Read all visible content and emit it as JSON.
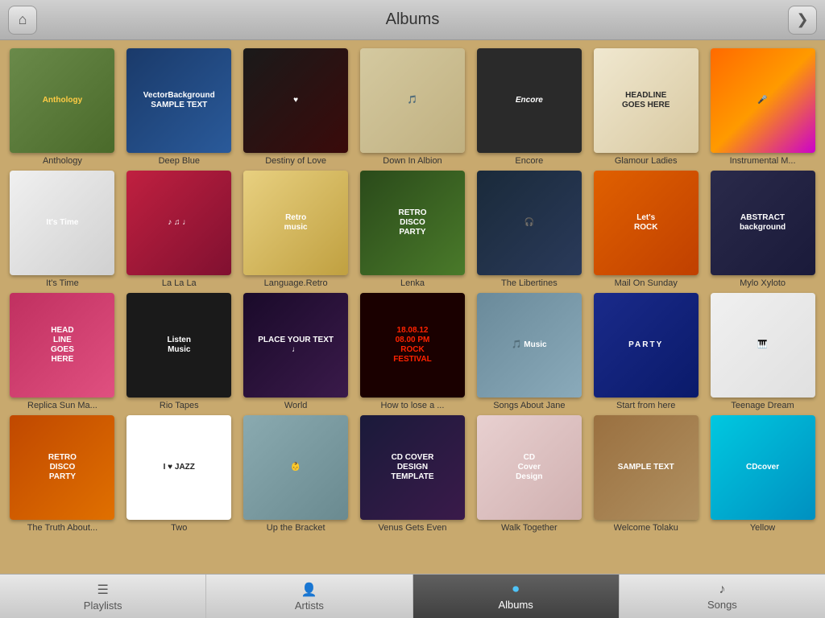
{
  "header": {
    "title": "Albums",
    "home_btn": "⌂",
    "back_btn": "❯"
  },
  "albums": [
    {
      "id": "anthology",
      "title": "Anthology",
      "cover_class": "anthology-cover",
      "cover_text": "Anthology"
    },
    {
      "id": "deepblue",
      "title": "Deep Blue",
      "cover_class": "cover-deepblue",
      "cover_text": "VectorBackground\nSAMPLE TEXT"
    },
    {
      "id": "destiny",
      "title": "Destiny of Love",
      "cover_class": "cover-destiny",
      "cover_text": "♥"
    },
    {
      "id": "downalbion",
      "title": "Down In Albion",
      "cover_class": "cover-downalbion",
      "cover_text": "🎵"
    },
    {
      "id": "encore",
      "title": "Encore",
      "cover_class": "encore-cover",
      "cover_text": "Encore"
    },
    {
      "id": "glamour",
      "title": "Glamour Ladies",
      "cover_class": "headline2-cover",
      "cover_text": "HEADLINE\nGOES HERE"
    },
    {
      "id": "instrumental",
      "title": "Instrumental M...",
      "cover_class": "cover-instrumental",
      "cover_text": "🎤"
    },
    {
      "id": "itstime",
      "title": "It's Time",
      "cover_class": "cover-itstime",
      "cover_text": "It's Time"
    },
    {
      "id": "lalala",
      "title": "La La La",
      "cover_class": "cover-lalala",
      "cover_text": "♪ ♫ ♩"
    },
    {
      "id": "retro",
      "title": "Language.Retro",
      "cover_class": "cover-retro",
      "cover_text": "Retro\nmusic"
    },
    {
      "id": "lenka",
      "title": "Lenka",
      "cover_class": "cover-lenka",
      "cover_text": "RETRO\nDISCO\nPARTY"
    },
    {
      "id": "libertines",
      "title": "The Libertines",
      "cover_class": "cover-libertines",
      "cover_text": "🎧"
    },
    {
      "id": "mailonsunday",
      "title": "Mail On Sunday",
      "cover_class": "letsrock-cover",
      "cover_text": "Let's\nROCK"
    },
    {
      "id": "mylo",
      "title": "Mylo Xyloto",
      "cover_class": "abstract-cover",
      "cover_text": "ABSTRACT\nbackground"
    },
    {
      "id": "replica",
      "title": "Replica Sun Ma...",
      "cover_class": "headline-cover",
      "cover_text": "HEAD\nLINE\nGOES\nHERE"
    },
    {
      "id": "rio",
      "title": "Rio Tapes",
      "cover_class": "listenmusic-cover",
      "cover_text": "Listen\nMusic"
    },
    {
      "id": "world",
      "title": "World",
      "cover_class": "cover-world",
      "cover_text": "PLACE YOUR TEXT\n♩"
    },
    {
      "id": "howtlose",
      "title": "How to lose a ...",
      "cover_class": "rock-cover",
      "cover_text": "18.08.12\n08.00 PM\nROCK\nFESTIVAL"
    },
    {
      "id": "songs",
      "title": "Songs About Jane",
      "cover_class": "cover-songs",
      "cover_text": "🎵 Music"
    },
    {
      "id": "start",
      "title": "Start from here",
      "cover_class": "party-cover",
      "cover_text": "PARTY"
    },
    {
      "id": "teenage",
      "title": "Teenage Dream",
      "cover_class": "cover-teenage",
      "cover_text": "🎹"
    },
    {
      "id": "truth",
      "title": "The Truth About...",
      "cover_class": "retrodisco-cover",
      "cover_text": "RETRO\nDISCO\nPARTY"
    },
    {
      "id": "two",
      "title": "Two",
      "cover_class": "ilovejazz-cover",
      "cover_text": "I ♥ JAZZ"
    },
    {
      "id": "upbracket",
      "title": "Up the Bracket",
      "cover_class": "cover-upbracket",
      "cover_text": "👶"
    },
    {
      "id": "venus",
      "title": "Venus Gets Even",
      "cover_class": "cover-venus",
      "cover_text": "CD COVER\nDESIGN\nTEMPLATE"
    },
    {
      "id": "walk",
      "title": "Walk Together",
      "cover_class": "cover-walktogether",
      "cover_text": "CD\nCover\nDesign"
    },
    {
      "id": "welcome",
      "title": "Welcome Tolaku",
      "cover_class": "cover-welcome",
      "cover_text": "SAMPLE TEXT"
    },
    {
      "id": "yellow",
      "title": "Yellow",
      "cover_class": "cover-yellow",
      "cover_text": "CDcover"
    }
  ],
  "footer": {
    "tabs": [
      {
        "id": "playlists",
        "label": "Playlists",
        "icon": "☰",
        "active": false
      },
      {
        "id": "artists",
        "label": "Artists",
        "icon": "👤",
        "active": false
      },
      {
        "id": "albums",
        "label": "Albums",
        "icon": "⏺",
        "active": true
      },
      {
        "id": "songs",
        "label": "Songs",
        "icon": "♪",
        "active": false
      }
    ]
  }
}
